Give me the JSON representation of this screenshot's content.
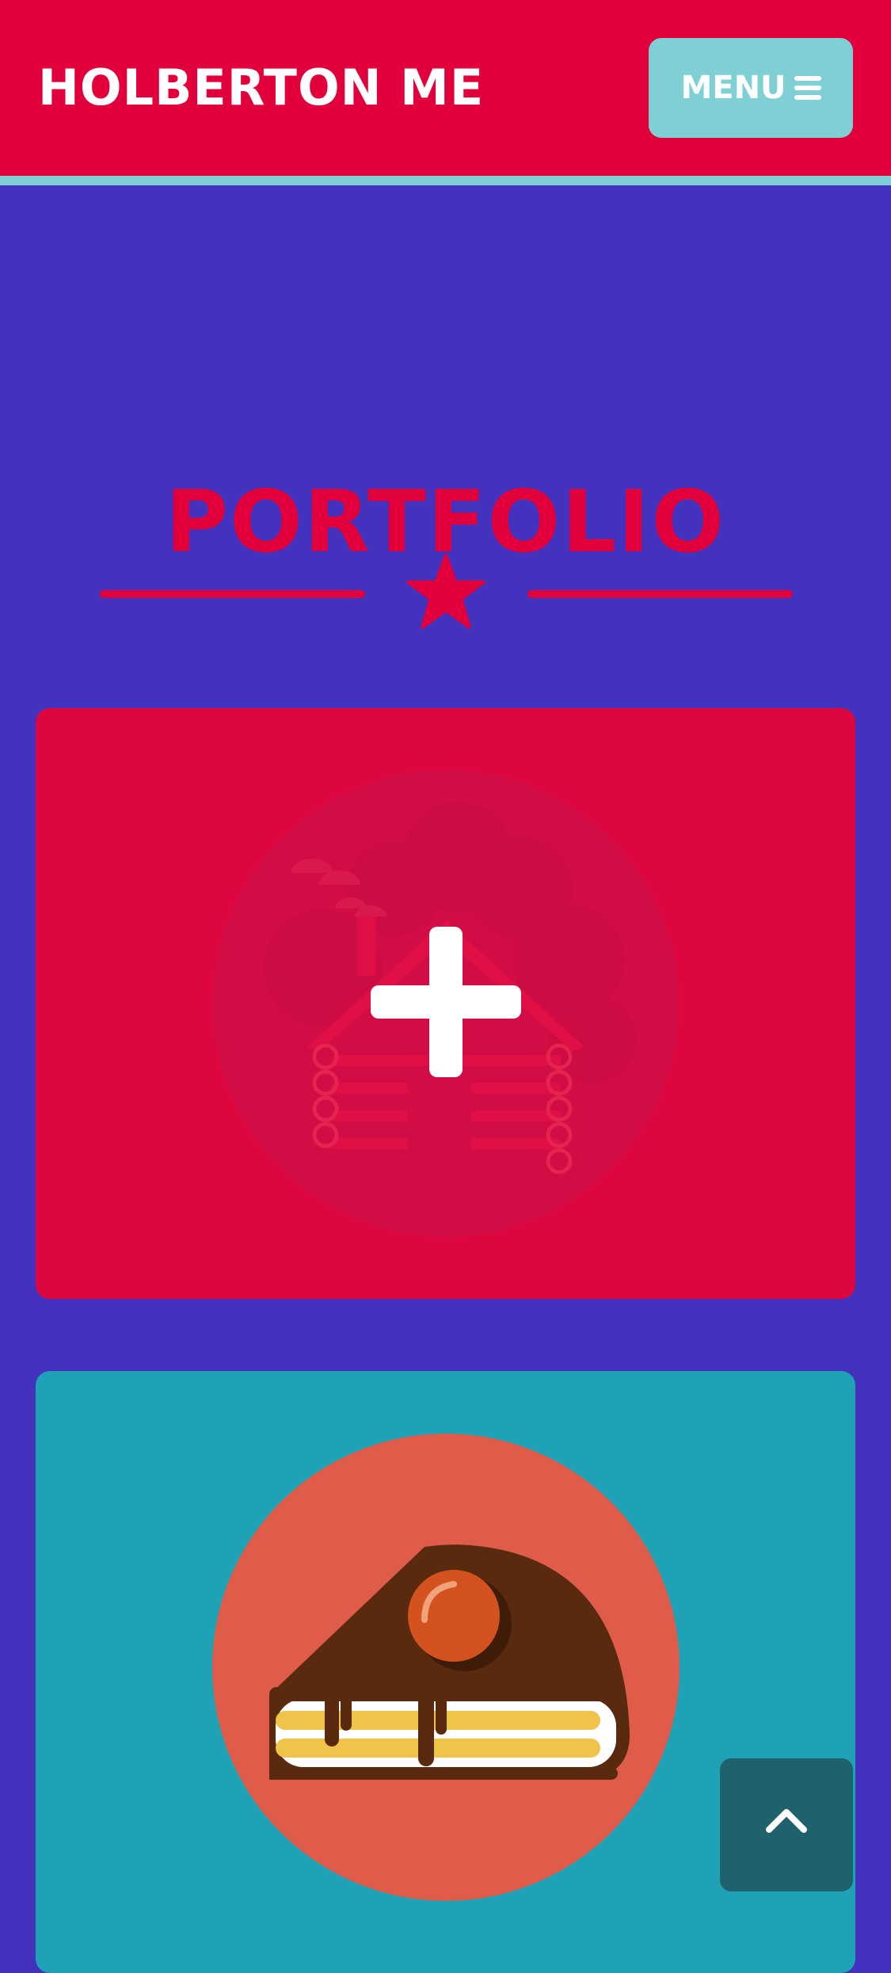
{
  "navbar": {
    "brand": "HOLBERTON ME",
    "menu_label": "MENU"
  },
  "portfolio": {
    "title": "PORTFOLIO",
    "items": [
      {
        "icon": "cabin-icon",
        "overlay_icon": "plus-icon"
      },
      {
        "icon": "cake-icon"
      }
    ]
  },
  "colors": {
    "navbar_bg": "#e1003b",
    "accent_teal": "#7ed0d4",
    "page_bg": "#4232bd",
    "card_red": "#dd063f",
    "card_teal": "#20a2b6",
    "scroll_top_bg": "#20616e"
  },
  "controls": {
    "scroll_top_icon": "chevron-up-icon"
  }
}
